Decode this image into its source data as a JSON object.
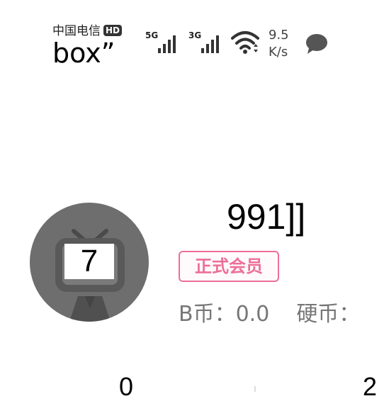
{
  "status_bar": {
    "carrier": "中国电信",
    "hd_badge": "HD",
    "app_label": "box”",
    "signal1_label": "5G",
    "signal2_label": "3G",
    "wifi_icon": "wifi-icon",
    "speed_value": "9.5",
    "speed_unit": "K/s",
    "message_icon": "chat-bubble-icon"
  },
  "profile": {
    "level": "7",
    "username": "991]]",
    "vip_badge": "正式会员",
    "b_coin_label": "B币：",
    "b_coin_value": "0.0",
    "hard_coin_label": "硬币："
  },
  "stats": {
    "first_value": "0",
    "second_value": "2"
  },
  "colors": {
    "vip_pink": "#ec6f97",
    "avatar_gray": "#6e6e6e",
    "muted_text": "#777777"
  }
}
